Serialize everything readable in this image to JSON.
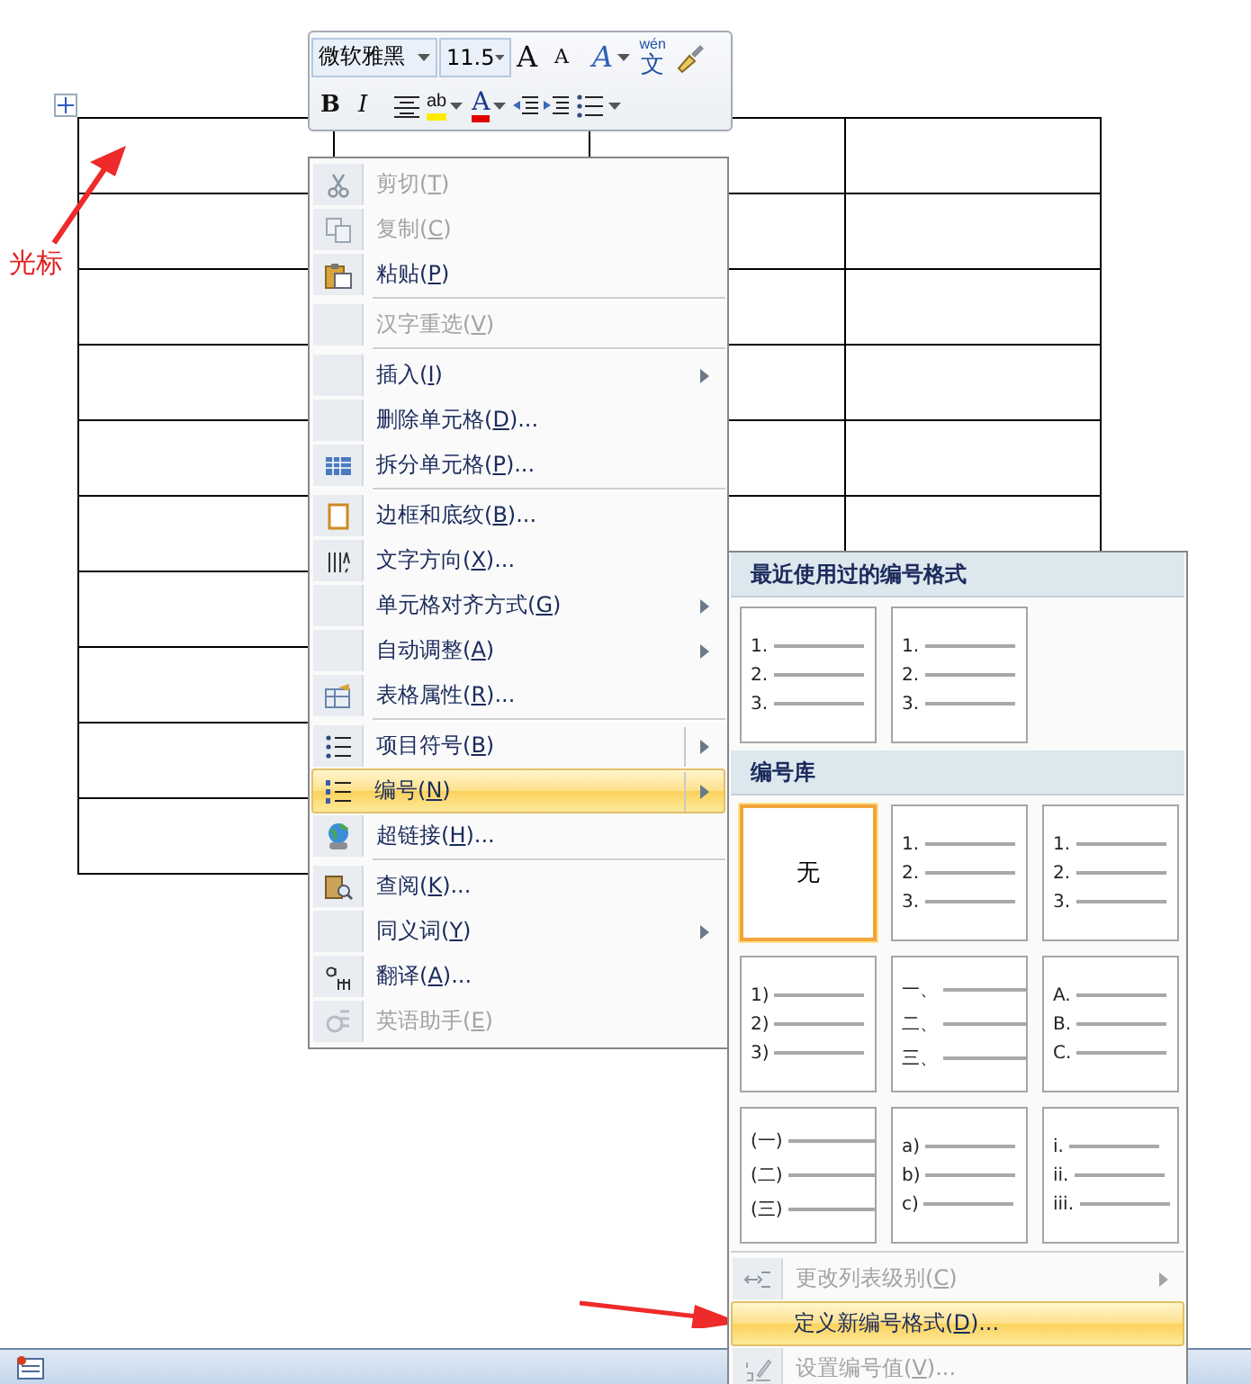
{
  "annotations": [
    {
      "kind": "label-arrow",
      "text": "光标"
    },
    {
      "kind": "arrow"
    }
  ],
  "mini_toolbar": {
    "font": "微软雅黑",
    "size": "11.5",
    "row_1": [
      {
        "kind": "grow",
        "label": "A"
      },
      {
        "kind": "shrink",
        "label": "A"
      },
      {
        "kind": "styles",
        "label": "A"
      },
      {
        "kind": "phonetic",
        "label": "文",
        "ruby": "wén"
      },
      {
        "kind": "painter"
      }
    ],
    "row_2": [
      {
        "kind": "bold",
        "label": "B"
      },
      {
        "kind": "italic",
        "label": "I"
      },
      {
        "kind": "center"
      },
      {
        "kind": "highlight",
        "label": "ab"
      },
      {
        "kind": "fontcolor",
        "label": "A"
      },
      {
        "kind": "outdent"
      },
      {
        "kind": "indent"
      },
      {
        "kind": "bullets"
      }
    ]
  },
  "context_menu": [
    {
      "kind": "item",
      "label": "剪切(T)",
      "disabled": true,
      "submenu": false,
      "split": false,
      "selected": false
    },
    {
      "kind": "item",
      "label": "复制(C)",
      "disabled": true,
      "submenu": false,
      "split": false,
      "selected": false
    },
    {
      "kind": "item",
      "label": "粘贴(P)",
      "disabled": false,
      "submenu": false,
      "split": false,
      "selected": false
    },
    {
      "kind": "separator"
    },
    {
      "kind": "item",
      "label": "汉字重选(V)",
      "disabled": true,
      "submenu": false,
      "split": false,
      "selected": false
    },
    {
      "kind": "separator"
    },
    {
      "kind": "item",
      "label": "插入(I)",
      "disabled": false,
      "submenu": true,
      "split": false,
      "selected": false
    },
    {
      "kind": "item",
      "label": "删除单元格(D)...",
      "disabled": false,
      "submenu": false,
      "split": false,
      "selected": false
    },
    {
      "kind": "item",
      "label": "拆分单元格(P)...",
      "disabled": false,
      "submenu": false,
      "split": false,
      "selected": false
    },
    {
      "kind": "separator"
    },
    {
      "kind": "item",
      "label": "边框和底纹(B)...",
      "disabled": false,
      "submenu": false,
      "split": false,
      "selected": false
    },
    {
      "kind": "item",
      "label": "文字方向(X)...",
      "disabled": false,
      "submenu": false,
      "split": false,
      "selected": false
    },
    {
      "kind": "item",
      "label": "单元格对齐方式(G)",
      "disabled": false,
      "submenu": true,
      "split": false,
      "selected": false
    },
    {
      "kind": "item",
      "label": "自动调整(A)",
      "disabled": false,
      "submenu": true,
      "split": false,
      "selected": false
    },
    {
      "kind": "item",
      "label": "表格属性(R)...",
      "disabled": false,
      "submenu": false,
      "split": false,
      "selected": false
    },
    {
      "kind": "separator"
    },
    {
      "kind": "item",
      "label": "项目符号(B)",
      "disabled": false,
      "submenu": true,
      "split": true,
      "selected": false
    },
    {
      "kind": "item",
      "label": "编号(N)",
      "disabled": false,
      "submenu": true,
      "split": true,
      "selected": true
    },
    {
      "kind": "item",
      "label": "超链接(H)...",
      "disabled": false,
      "submenu": false,
      "split": false,
      "selected": false
    },
    {
      "kind": "separator"
    },
    {
      "kind": "item",
      "label": "查阅(K)...",
      "disabled": false,
      "submenu": false,
      "split": false,
      "selected": false
    },
    {
      "kind": "item",
      "label": "同义词(Y)",
      "disabled": false,
      "submenu": true,
      "split": false,
      "selected": false
    },
    {
      "kind": "item",
      "label": "翻译(A)...",
      "disabled": false,
      "submenu": false,
      "split": false,
      "selected": false
    },
    {
      "kind": "item",
      "label": "英语助手(E)",
      "disabled": true,
      "submenu": false,
      "split": false,
      "selected": false
    }
  ],
  "numbering_menu": {
    "sections": [
      {
        "title": "最近使用过的编号格式",
        "tiles": [
          {
            "kind": "list",
            "lines": [
              "1.",
              "2.",
              "3."
            ],
            "selected": false
          },
          {
            "kind": "list",
            "lines": [
              "1.",
              "2.",
              "3."
            ],
            "selected": false
          }
        ]
      },
      {
        "title": "编号库",
        "tiles": [
          {
            "kind": "none",
            "label": "无",
            "selected": true
          },
          {
            "kind": "list",
            "lines": [
              "1.",
              "2.",
              "3."
            ],
            "selected": false
          },
          {
            "kind": "list",
            "lines": [
              "1.",
              "2.",
              "3."
            ],
            "selected": false
          },
          {
            "kind": "list",
            "lines": [
              "1)",
              "2)",
              "3)"
            ],
            "selected": false
          },
          {
            "kind": "list",
            "lines": [
              "一、",
              "二、",
              "三、"
            ],
            "selected": false
          },
          {
            "kind": "list",
            "lines": [
              "A.",
              "B.",
              "C."
            ],
            "selected": false
          },
          {
            "kind": "list",
            "lines": [
              "(一)",
              "(二)",
              "(三)"
            ],
            "selected": false
          },
          {
            "kind": "list",
            "lines": [
              "a)",
              "b)",
              "c)"
            ],
            "selected": false
          },
          {
            "kind": "list",
            "lines": [
              "i.",
              "ii.",
              "iii."
            ],
            "selected": false
          }
        ]
      }
    ],
    "commands": [
      {
        "kind": "item",
        "label": "更改列表级别(C)",
        "disabled": true,
        "submenu": true,
        "split": false,
        "selected": false
      },
      {
        "kind": "item",
        "label": "定义新编号格式(D)...",
        "disabled": false,
        "submenu": false,
        "split": false,
        "selected": true
      },
      {
        "kind": "item",
        "label": "设置编号值(V)...",
        "disabled": true,
        "submenu": false,
        "split": false,
        "selected": false
      }
    ]
  }
}
